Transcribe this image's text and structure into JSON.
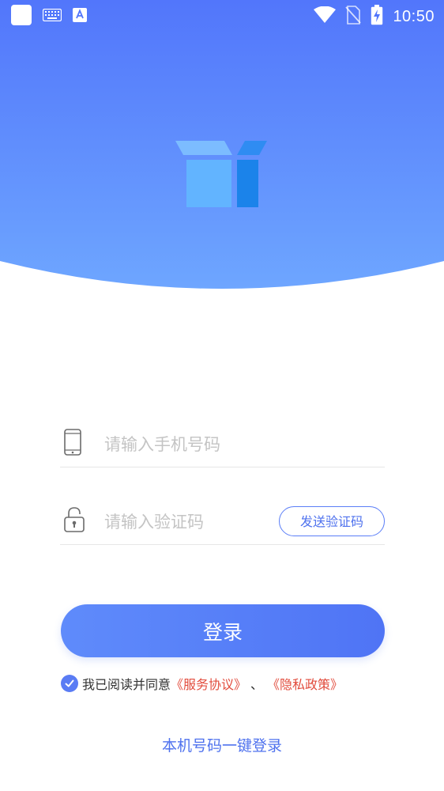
{
  "status_bar": {
    "time": "10:50",
    "left_icons": [
      "app-square-icon",
      "keyboard-icon",
      "font-a-icon"
    ],
    "right_icons": [
      "wifi-icon",
      "no-sim-icon",
      "battery-charging-icon"
    ]
  },
  "hero": {
    "gradient_top": "#5276fb",
    "gradient_bottom": "#6ea6ff",
    "logo_icon": "app-logo-box-icon"
  },
  "form": {
    "phone_placeholder": "请输入手机号码",
    "phone_value": "",
    "code_placeholder": "请输入验证码",
    "code_value": "",
    "send_code_label": "发送验证码"
  },
  "login_button": {
    "label": "登录"
  },
  "agreement": {
    "checked": true,
    "text": "我已阅读并同意",
    "service_link": "《服务协议》",
    "separator": "、",
    "privacy_link": "《隐私政策》"
  },
  "one_key_login": {
    "label": "本机号码一键登录"
  },
  "colors": {
    "accent": "#4f72ee",
    "link_red": "#e24c3d",
    "divider": "#e6e6e6"
  }
}
